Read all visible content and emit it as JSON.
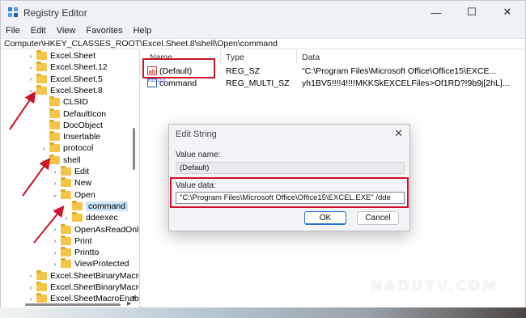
{
  "window": {
    "title": "Registry Editor",
    "minimize_glyph": "—",
    "maximize_glyph": "☐",
    "close_glyph": "✕"
  },
  "menu": [
    "File",
    "Edit",
    "View",
    "Favorites",
    "Help"
  ],
  "address": "Computer\\HKEY_CLASSES_ROOT\\Excel.Sheet.8\\shell\\Open\\command",
  "tree": [
    {
      "label": "Excel.Sheet",
      "chevron": "›",
      "selected": false
    },
    {
      "label": "Excel.Sheet.12",
      "chevron": "›",
      "selected": false
    },
    {
      "label": "Excel.Sheet.5",
      "chevron": "›",
      "selected": false
    },
    {
      "label": "Excel.Sheet.8",
      "chevron": "⌄",
      "selected": false
    },
    {
      "label": "CLSID",
      "chevron": "",
      "selected": false
    },
    {
      "label": "DefaultIcon",
      "chevron": "",
      "selected": false
    },
    {
      "label": "DocObject",
      "chevron": "",
      "selected": false
    },
    {
      "label": "Insertable",
      "chevron": "",
      "selected": false
    },
    {
      "label": "protocol",
      "chevron": "›",
      "selected": false
    },
    {
      "label": "shell",
      "chevron": "⌄",
      "selected": false
    },
    {
      "label": "Edit",
      "chevron": "›",
      "selected": false
    },
    {
      "label": "New",
      "chevron": "›",
      "selected": false
    },
    {
      "label": "Open",
      "chevron": "⌄",
      "selected": false
    },
    {
      "label": "command",
      "chevron": "",
      "selected": true
    },
    {
      "label": "ddeexec",
      "chevron": "›",
      "selected": false
    },
    {
      "label": "OpenAsReadOnly",
      "chevron": "›",
      "selected": false
    },
    {
      "label": "Print",
      "chevron": "›",
      "selected": false
    },
    {
      "label": "Printto",
      "chevron": "›",
      "selected": false
    },
    {
      "label": "ViewProtected",
      "chevron": "›",
      "selected": false
    },
    {
      "label": "Excel.SheetBinaryMacro",
      "chevron": "›",
      "selected": false
    },
    {
      "label": "Excel.SheetBinaryMacro",
      "chevron": "›",
      "selected": false
    },
    {
      "label": "Excel.SheetMacroEnabl",
      "chevron": "›",
      "selected": false
    }
  ],
  "list": {
    "headers": {
      "name": "Name",
      "type": "Type",
      "data": "Data"
    },
    "rows": [
      {
        "icon": "string-value-icon",
        "icon_text": "ab",
        "name": "(Default)",
        "type": "REG_SZ",
        "data": "\"C:\\Program Files\\Microsoft Office\\Office15\\EXCE..."
      },
      {
        "icon": "binary-value-icon",
        "icon_text": "011\n110",
        "name": "command",
        "type": "REG_MULTI_SZ",
        "data": "yh1BV5!!!!4!!!!MKKSkEXCELFiles>Of1RD?!9b9j[2hL]..."
      }
    ]
  },
  "dialog": {
    "title": "Edit String",
    "close_glyph": "✕",
    "value_name_label": "Value name:",
    "value_name": "(Default)",
    "value_data_label": "Value data:",
    "value_data": "\"C:\\Program Files\\Microsoft Office\\Office15\\EXCEL.EXE\" /dde",
    "ok_label": "OK",
    "cancel_label": "Cancel"
  },
  "watermark": "NADUTV.COM",
  "colors": {
    "annotation_red": "#d0112b",
    "selection_blue": "#cce4f7",
    "folder_yellow": "#f3c64a"
  }
}
